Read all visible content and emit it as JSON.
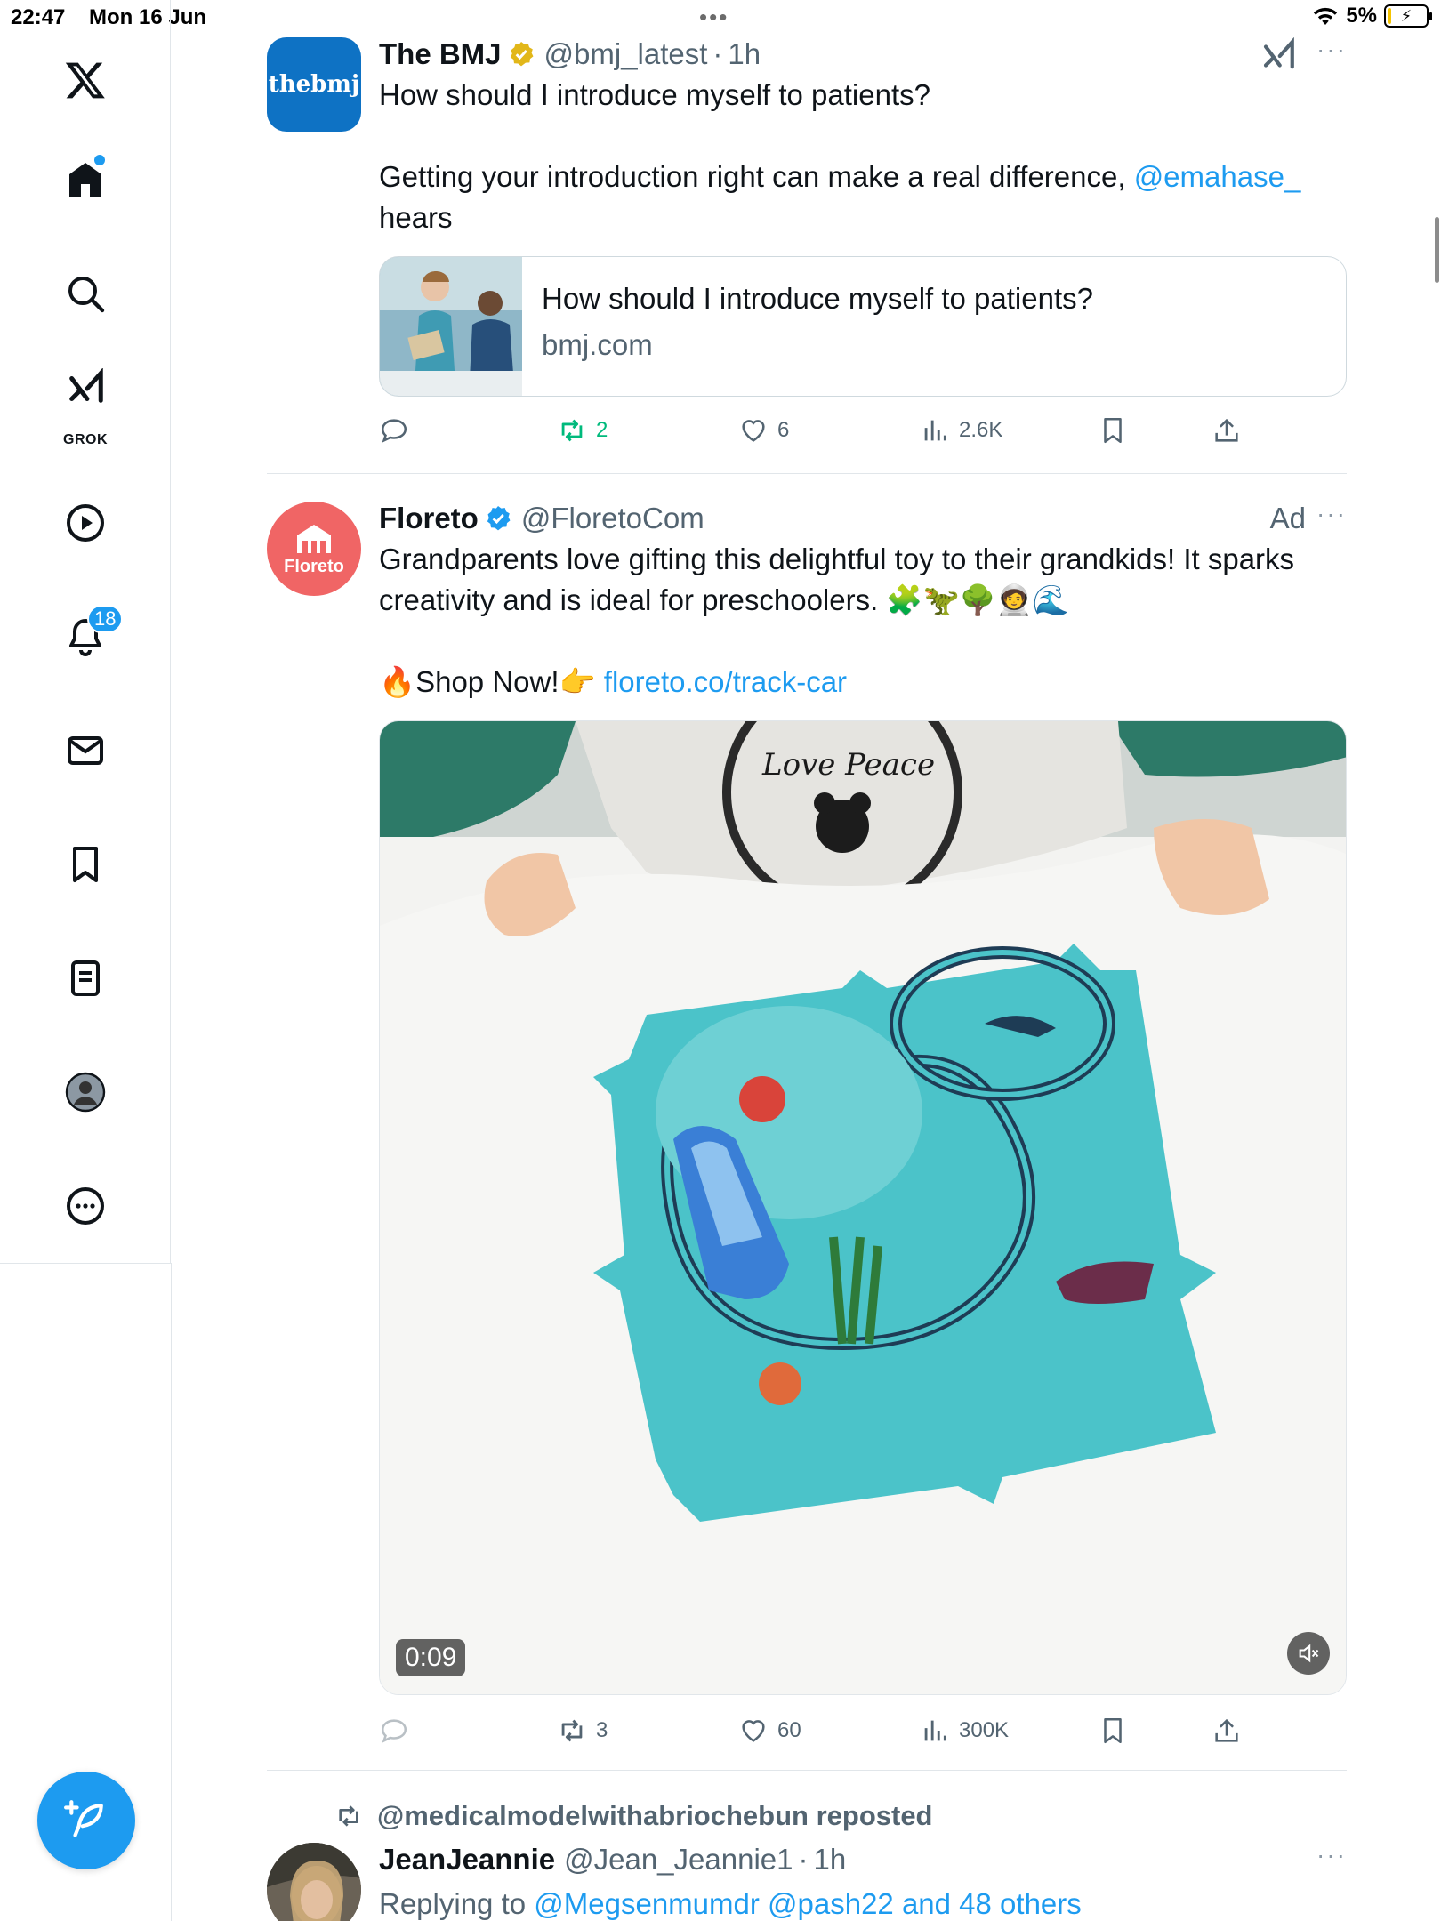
{
  "status_bar": {
    "time": "22:47",
    "date": "Mon 16 Jun",
    "battery": "5%"
  },
  "sidebar": {
    "grok_label": "GROK",
    "notifications_badge": "18"
  },
  "tweets": [
    {
      "name": "The BMJ",
      "handle": "@bmj_latest",
      "time": "1h",
      "avatar_text": "thebmj",
      "text_line1": "How should I introduce myself to patients?",
      "text_line2_prefix": "Getting your introduction right can make a real difference, ",
      "mention": "@emahase_",
      "text_line2_suffix": "hears",
      "card": {
        "title": "How should I introduce myself to patients?",
        "domain": "bmj.com"
      },
      "stats": {
        "reposts": "2",
        "likes": "6",
        "views": "2.6K"
      }
    },
    {
      "name": "Floreto",
      "handle": "@FloretoCom",
      "ad_label": "Ad",
      "avatar_text": "Floreto",
      "text_line1": "Grandparents love gifting this delightful toy to their grandkids! It sparks",
      "text_line2": "creativity and is ideal for preschoolers. 🧩🦖🌳🧑‍🚀🌊",
      "shop_text": "🔥Shop Now!👉 ",
      "shop_link": "floreto.co/track-car",
      "video_time": "0:09",
      "stats": {
        "reposts": "3",
        "likes": "60",
        "views": "300K"
      }
    },
    {
      "repost_by": "@medicalmodelwithabriochebun reposted",
      "name": "JeanJeannie",
      "handle": "@Jean_Jeannie1",
      "time": "1h",
      "reply_prefix": "Replying to ",
      "reply_to": "@Megsenmumdr @pash22 and 48 others"
    }
  ],
  "colors": {
    "accent": "#1d9bf0",
    "repost_green": "#00ba7c",
    "bmj_blue": "#0e72c4",
    "floreto_red": "#f05656"
  }
}
